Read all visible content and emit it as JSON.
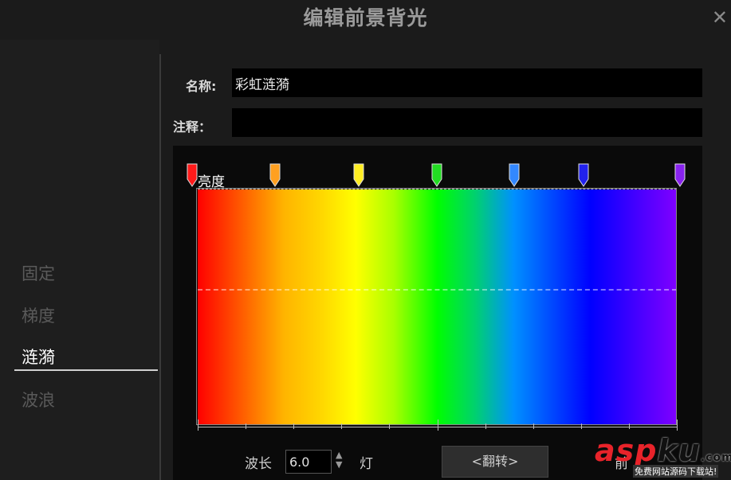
{
  "dialog": {
    "title": "编辑前景背光",
    "close_icon": "close-icon"
  },
  "modes": [
    {
      "label": "固定",
      "active": false
    },
    {
      "label": "梯度",
      "active": false
    },
    {
      "label": "涟漪",
      "active": true
    },
    {
      "label": "波浪",
      "active": false
    }
  ],
  "form": {
    "name_label": "名称:",
    "name_value": "彩虹涟漪",
    "note_label": "注释：",
    "note_value": ""
  },
  "editor": {
    "brightness_label": "亮度",
    "marker_colors": [
      "#ff1a1a",
      "#ffa020",
      "#ffee22",
      "#22dd22",
      "#3388ff",
      "#2222ee",
      "#8822ee"
    ]
  },
  "controls": {
    "wavelength_label": "波长",
    "wavelength_value": "6.0",
    "spinner_glyph": "▲▼",
    "lamp_label": "灯",
    "flip_label": "<翻转>",
    "front_label": "前"
  },
  "watermark": {
    "brand_red": "asp",
    "brand_black": "ku",
    "domain_suffix": ".com",
    "tagline": "免费网站源码下载站!"
  }
}
